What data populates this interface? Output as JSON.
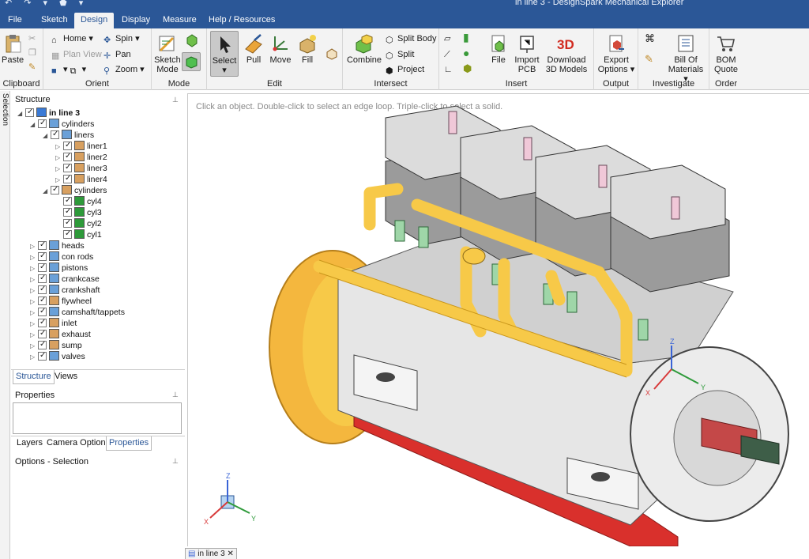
{
  "window": {
    "title": "in line 3 - DesignSpark Mechanical Explorer",
    "quick_access": "↶ ↷ ▾ ⬟ ▾"
  },
  "menu": {
    "tabs": [
      {
        "label": "File"
      },
      {
        "label": "Sketch"
      },
      {
        "label": "Design"
      },
      {
        "label": "Display"
      },
      {
        "label": "Measure"
      },
      {
        "label": "Help / Resources"
      }
    ],
    "active": "Design"
  },
  "ribbon": {
    "clipboard": {
      "label": "Clipboard",
      "paste": "Paste"
    },
    "orient": {
      "label": "Orient",
      "home": "Home",
      "plan_view": "Plan View",
      "spin": "Spin",
      "pan": "Pan",
      "zoom": "Zoom"
    },
    "mode": {
      "label": "Mode",
      "sketch_mode": "Sketch Mode"
    },
    "edit": {
      "label": "Edit",
      "select": "Select",
      "pull": "Pull",
      "move": "Move",
      "fill": "Fill"
    },
    "intersect": {
      "label": "Intersect",
      "combine": "Combine",
      "split_body": "Split Body",
      "split": "Split",
      "project": "Project"
    },
    "insert": {
      "label": "Insert",
      "file": "File",
      "import_pcb": "Import PCB",
      "download_3d": "Download 3D Models"
    },
    "output": {
      "label": "Output",
      "export_options": "Export Options"
    },
    "investigate": {
      "label": "Investigate",
      "bill_of_materials": "Bill Of Materials"
    },
    "order": {
      "label": "Order",
      "bom_quote": "BOM Quote"
    }
  },
  "side_strip": "Selection",
  "structure": {
    "title": "Structure",
    "tree": [
      {
        "label": "in line 3",
        "level": 0,
        "expanded": true,
        "icon": "assembly-icon",
        "bold": true
      },
      {
        "label": "cylinders",
        "level": 1,
        "expanded": true,
        "icon": "component-icon"
      },
      {
        "label": "liners",
        "level": 2,
        "expanded": true,
        "icon": "component-icon"
      },
      {
        "label": "liner1",
        "level": 3,
        "expanded": false,
        "icon": "part-icon"
      },
      {
        "label": "liner2",
        "level": 3,
        "expanded": false,
        "icon": "part-icon"
      },
      {
        "label": "liner3",
        "level": 3,
        "expanded": false,
        "icon": "part-icon"
      },
      {
        "label": "liner4",
        "level": 3,
        "expanded": false,
        "icon": "part-icon"
      },
      {
        "label": "cylinders",
        "level": 2,
        "expanded": true,
        "icon": "part-icon"
      },
      {
        "label": "cyl4",
        "level": 3,
        "expanded": null,
        "icon": "solid-icon"
      },
      {
        "label": "cyl3",
        "level": 3,
        "expanded": null,
        "icon": "solid-icon"
      },
      {
        "label": "cyl2",
        "level": 3,
        "expanded": null,
        "icon": "solid-icon"
      },
      {
        "label": "cyl1",
        "level": 3,
        "expanded": null,
        "icon": "solid-icon"
      },
      {
        "label": "heads",
        "level": 1,
        "expanded": false,
        "icon": "component-icon"
      },
      {
        "label": "con rods",
        "level": 1,
        "expanded": false,
        "icon": "component-icon"
      },
      {
        "label": "pistons",
        "level": 1,
        "expanded": false,
        "icon": "component-icon"
      },
      {
        "label": "crankcase",
        "level": 1,
        "expanded": false,
        "icon": "component-icon"
      },
      {
        "label": "crankshaft",
        "level": 1,
        "expanded": false,
        "icon": "component-icon"
      },
      {
        "label": "flywheel",
        "level": 1,
        "expanded": false,
        "icon": "part-icon"
      },
      {
        "label": "camshaft/tappets",
        "level": 1,
        "expanded": false,
        "icon": "component-icon"
      },
      {
        "label": "inlet",
        "level": 1,
        "expanded": false,
        "icon": "part-icon"
      },
      {
        "label": "exhaust",
        "level": 1,
        "expanded": false,
        "icon": "part-icon"
      },
      {
        "label": "sump",
        "level": 1,
        "expanded": false,
        "icon": "part-icon"
      },
      {
        "label": "valves",
        "level": 1,
        "expanded": false,
        "icon": "component-icon"
      }
    ],
    "tabs": [
      {
        "label": "Structure"
      },
      {
        "label": "Views"
      }
    ]
  },
  "properties": {
    "title": "Properties",
    "tabs": [
      {
        "label": "Layers"
      },
      {
        "label": "Camera Options"
      },
      {
        "label": "Properties"
      }
    ]
  },
  "options": {
    "title": "Options - Selection"
  },
  "viewport": {
    "hint": "Click an object. Double-click to select an edge loop. Triple-click to select a solid.",
    "triad": {
      "z": "Z",
      "x": "X",
      "y": "Y"
    },
    "model_triad": {
      "z": "Z",
      "x": "X",
      "y": "Y"
    }
  },
  "document_tab": {
    "label": "in line 3"
  },
  "colors": {
    "ribbon_blue": "#2b5797",
    "pipe_yellow": "#f7c948",
    "flywheel_orange": "#f4b73e",
    "sump_red": "#d9302c",
    "crankcase_grey": "#e6e6e6"
  }
}
